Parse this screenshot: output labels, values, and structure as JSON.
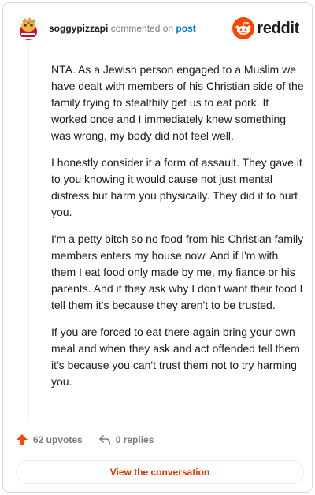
{
  "comment": {
    "username": "soggypizzapi",
    "action_text": "commented on",
    "post_link": "post",
    "brand": "reddit",
    "paragraphs": [
      "NTA. As a Jewish person engaged to a Muslim we have dealt with members of his Christian side of the family trying to stealthily get us to eat pork. It worked once and I immediately knew something was wrong, my body did not feel well.",
      "I honestly consider it a form of assault. They gave it to you knowing it would cause not just mental distress but harm you physically. They did it to hurt you.",
      "I'm a petty bitch so no food from his Christian family members enters my house now. And if I'm with them I eat food only made by me, my fiance or his parents. And if they ask why I don't want their food I tell them it's because they aren't to be trusted.",
      "If you are forced to eat there again bring your own meal and when they ask and act offended tell them it's because you can't trust them not to try harming you."
    ]
  },
  "actions": {
    "upvotes": "62 upvotes",
    "replies": "0 replies"
  },
  "cta_label": "View the conversation",
  "icons": {
    "avatar": "snoo-avatar-icon",
    "brand_logo": "reddit-snoo-icon",
    "upvote": "upvote-arrow-icon",
    "reply": "reply-arrow-icon"
  },
  "colors": {
    "accent": "#ff4500",
    "link": "#0079d3",
    "cta_text": "#d93a00"
  }
}
